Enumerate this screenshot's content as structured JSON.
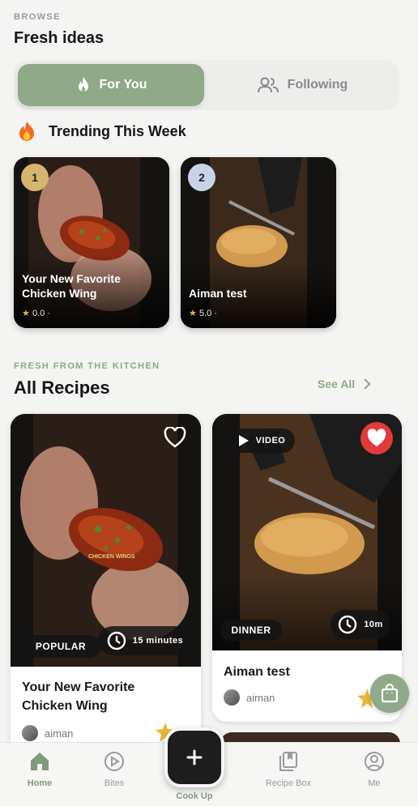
{
  "header": {
    "kicker": "BROWSE",
    "title": "Fresh ideas"
  },
  "toggle": {
    "active": "For You",
    "inactive": "Following"
  },
  "trending": {
    "title": "Trending This Week",
    "cards": [
      {
        "rank": "1",
        "title": "Your New Favorite Chicken Wing",
        "rating": "0.0",
        "badge_color": "#d6b66f"
      },
      {
        "rank": "2",
        "title": "Aiman test",
        "rating": "5.0",
        "badge_color": "#c8d3e8"
      }
    ]
  },
  "recipes_section": {
    "kicker": "FRESH FROM THE KITCHEN",
    "title": "All Recipes",
    "see_all": "See All"
  },
  "recipes": [
    {
      "title": "Your New Favorite Chicken Wing",
      "tag": "POPULAR",
      "time": "15 minutes",
      "author": "aiman",
      "liked": false,
      "overlay_text": "CHICKEN WINGS"
    },
    {
      "title": "Aiman test",
      "tag": "DINNER",
      "time": "10m",
      "author": "aiman",
      "liked": true,
      "video_label": "VIDEO"
    }
  ],
  "tabs": [
    {
      "label": "Home",
      "icon": "home-icon"
    },
    {
      "label": "Bites",
      "icon": "play-circle-icon"
    },
    {
      "label": "Cook Up",
      "icon": "plus-icon"
    },
    {
      "label": "Recipe Box",
      "icon": "bookmark-stack-icon"
    },
    {
      "label": "Me",
      "icon": "user-icon"
    }
  ],
  "colors": {
    "accent": "#8fa989",
    "dark": "#1d1d1d",
    "heart": "#e23a3a",
    "star": "#e8b83a"
  }
}
